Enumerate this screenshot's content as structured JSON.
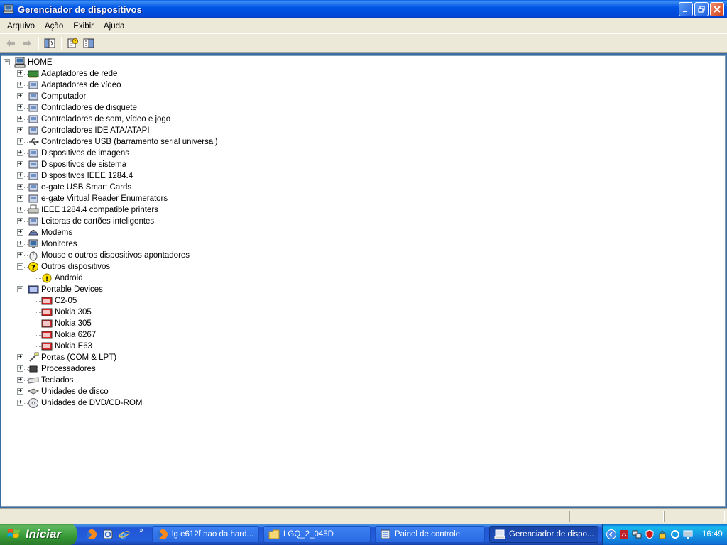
{
  "window": {
    "title": "Gerenciador de dispositivos",
    "controls": {
      "minimize": "‗",
      "maximize": "❐",
      "close": "✕"
    }
  },
  "menu": [
    "Arquivo",
    "Ação",
    "Exibir",
    "Ajuda"
  ],
  "toolbar": {
    "buttons": [
      "back-icon",
      "forward-icon",
      "show-hide-console-tree-icon",
      "properties-help-icon",
      "device-list-icon"
    ]
  },
  "tree": {
    "root": "HOME",
    "categories": [
      {
        "label": "Adaptadores de rede",
        "icon": "network-adapter-icon",
        "expanded": false
      },
      {
        "label": "Adaptadores de vídeo",
        "icon": "display-adapter-icon",
        "expanded": false
      },
      {
        "label": "Computador",
        "icon": "computer-icon",
        "expanded": false
      },
      {
        "label": "Controladores de disquete",
        "icon": "floppy-controller-icon",
        "expanded": false
      },
      {
        "label": "Controladores de som, vídeo e jogo",
        "icon": "sound-controller-icon",
        "expanded": false
      },
      {
        "label": "Controladores IDE ATA/ATAPI",
        "icon": "ide-controller-icon",
        "expanded": false
      },
      {
        "label": "Controladores USB (barramento serial universal)",
        "icon": "usb-icon",
        "expanded": false
      },
      {
        "label": "Dispositivos de imagens",
        "icon": "imaging-device-icon",
        "expanded": false
      },
      {
        "label": "Dispositivos de sistema",
        "icon": "system-device-icon",
        "expanded": false
      },
      {
        "label": "Dispositivos IEEE 1284.4",
        "icon": "ieee-device-icon",
        "expanded": false
      },
      {
        "label": "e-gate USB Smart Cards",
        "icon": "smart-card-icon",
        "expanded": false
      },
      {
        "label": "e-gate Virtual Reader Enumerators",
        "icon": "virtual-reader-icon",
        "expanded": false
      },
      {
        "label": "IEEE 1284.4 compatible printers",
        "icon": "printer-icon",
        "expanded": false
      },
      {
        "label": "Leitoras de cartões inteligentes",
        "icon": "smart-card-reader-icon",
        "expanded": false
      },
      {
        "label": "Modems",
        "icon": "modem-icon",
        "expanded": false
      },
      {
        "label": "Monitores",
        "icon": "monitor-icon",
        "expanded": false
      },
      {
        "label": "Mouse e outros dispositivos apontadores",
        "icon": "mouse-icon",
        "expanded": false
      },
      {
        "label": "Outros dispositivos",
        "icon": "unknown-device-icon",
        "expanded": true,
        "children": [
          {
            "label": "Android",
            "icon": "warning-device-icon"
          }
        ]
      },
      {
        "label": "Portable Devices",
        "icon": "portable-devices-icon",
        "expanded": true,
        "children": [
          {
            "label": "C2-05",
            "icon": "phone-icon"
          },
          {
            "label": "Nokia 305",
            "icon": "phone-icon"
          },
          {
            "label": "Nokia 305",
            "icon": "phone-icon"
          },
          {
            "label": "Nokia 6267",
            "icon": "phone-icon"
          },
          {
            "label": "Nokia E63",
            "icon": "phone-icon"
          }
        ]
      },
      {
        "label": "Portas (COM & LPT)",
        "icon": "port-icon",
        "expanded": false
      },
      {
        "label": "Processadores",
        "icon": "processor-icon",
        "expanded": false
      },
      {
        "label": "Teclados",
        "icon": "keyboard-icon",
        "expanded": false
      },
      {
        "label": "Unidades de disco",
        "icon": "disk-drive-icon",
        "expanded": false
      },
      {
        "label": "Unidades de DVD/CD-ROM",
        "icon": "cdrom-icon",
        "expanded": false
      }
    ]
  },
  "taskbar": {
    "start_label": "Iniciar",
    "quick_launch": [
      "firefox-icon",
      "ie-settings-icon",
      "ie-icon"
    ],
    "quick_launch_more": "»",
    "tasks": [
      {
        "label": "lg e612f nao da hard...",
        "icon": "firefox-icon",
        "active": false
      },
      {
        "label": "LGQ_2_045D",
        "icon": "folder-icon",
        "active": false
      },
      {
        "label": "Painel de controle",
        "icon": "control-panel-icon",
        "active": false
      },
      {
        "label": "Gerenciador de dispo...",
        "icon": "device-manager-icon",
        "active": true
      }
    ],
    "tray_icons": [
      "tray-expand-icon",
      "pdf-icon",
      "network-icon",
      "antivirus-icon",
      "security-icon",
      "update-icon",
      "display-icon"
    ],
    "clock": "16:49"
  }
}
